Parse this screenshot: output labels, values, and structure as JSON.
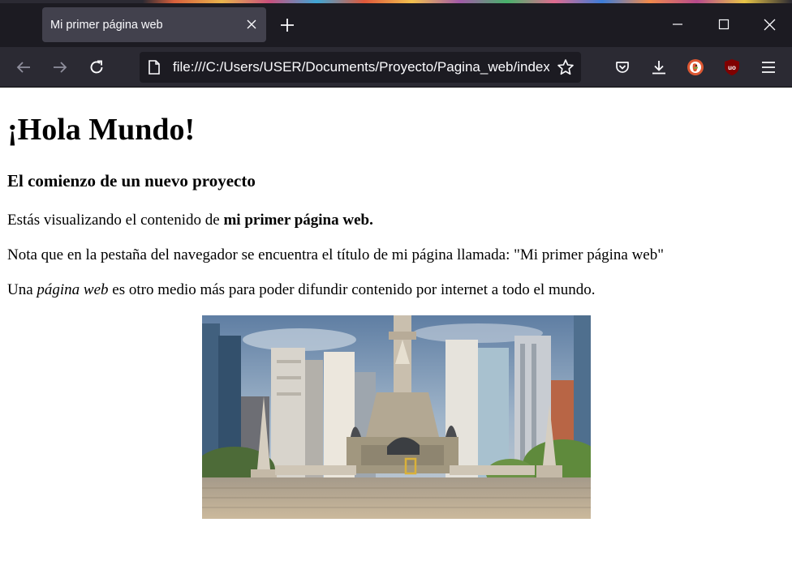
{
  "browser": {
    "tab": {
      "title": "Mi primer página web"
    },
    "toolbar": {
      "url": "file:///C:/Users/USER/Documents/Proyecto/Pagina_web/index.html"
    },
    "icons": [
      "back-arrow-icon",
      "forward-arrow-icon",
      "reload-icon",
      "page-icon",
      "star-icon",
      "pocket-icon",
      "download-icon",
      "duckduckgo-icon",
      "ublock-icon",
      "menu-icon"
    ],
    "colors": {
      "tabbar_bg": "#1c1b22",
      "toolbar_bg": "#2b2a33",
      "active_tab": "#42414d",
      "urlbar_bg": "#1c1b22",
      "text": "#fbfbfe"
    }
  },
  "page": {
    "heading": "¡Hola Mundo!",
    "subheading": "El comienzo de un nuevo proyecto",
    "p1": {
      "before": "Estás visualizando el contenido de ",
      "bold": "mi primer página web."
    },
    "p2": "Nota que en la pestaña del navegador se encuentra el título de mi página llamada: \"Mi primer página web\"",
    "p3": {
      "before": "Una ",
      "italic": "página web",
      "after": " es otro medio más para poder difundir contenido por internet a todo el mundo."
    }
  }
}
